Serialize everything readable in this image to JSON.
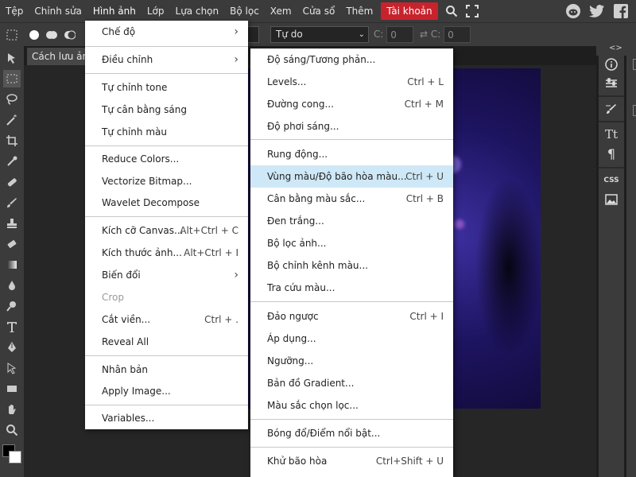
{
  "menubar": {
    "items": [
      "Tệp",
      "Chỉnh sửa",
      "Hình ảnh",
      "Lớp",
      "Lựa chọn",
      "Bộ lọc",
      "Xem",
      "Cửa sổ",
      "Thêm",
      "Tài khoản"
    ],
    "active_item": "Hình ảnh",
    "right_icons": [
      "reddit-icon",
      "twitter-icon",
      "facebook-icon"
    ]
  },
  "options_bar": {
    "style_select": "Tự do",
    "width_label": "C:",
    "width_value": "0",
    "height_label": "C:",
    "height_value": "0"
  },
  "document": {
    "tab_label": "Cách lưu ảnh"
  },
  "image_menu": {
    "items": [
      {
        "label": "Chế độ",
        "submenu": true
      },
      {
        "label": "Điều chỉnh",
        "submenu": true
      },
      {
        "label": "Tự chỉnh tone"
      },
      {
        "label": "Tự cân bằng sáng"
      },
      {
        "label": "Tự chỉnh màu"
      },
      {
        "label": "Reduce Colors..."
      },
      {
        "label": "Vectorize Bitmap..."
      },
      {
        "label": "Wavelet Decompose"
      },
      {
        "label": "Kích cỡ Canvas...",
        "shortcut": "Alt+Ctrl + C"
      },
      {
        "label": "Kích thước ảnh...",
        "shortcut": "Alt+Ctrl + I"
      },
      {
        "label": "Biến đổi",
        "submenu": true
      },
      {
        "label": "Crop",
        "disabled": true
      },
      {
        "label": "Cắt viền...",
        "shortcut": "Ctrl + ."
      },
      {
        "label": "Reveal All"
      },
      {
        "label": "Nhân bản"
      },
      {
        "label": "Apply Image..."
      },
      {
        "label": "Variables..."
      }
    ]
  },
  "adjust_menu": {
    "items": [
      {
        "label": "Độ sáng/Tương phản..."
      },
      {
        "label": "Levels...",
        "shortcut": "Ctrl + L"
      },
      {
        "label": "Đường cong...",
        "shortcut": "Ctrl + M"
      },
      {
        "label": "Độ phơi sáng..."
      },
      {
        "label": "Rung động..."
      },
      {
        "label": "Vùng màu/Độ bão hòa màu...",
        "shortcut": "Ctrl + U",
        "highlighted": true
      },
      {
        "label": "Cân bằng màu sắc...",
        "shortcut": "Ctrl + B"
      },
      {
        "label": "Đen trắng..."
      },
      {
        "label": "Bộ lọc ảnh..."
      },
      {
        "label": "Bộ chỉnh kênh màu..."
      },
      {
        "label": "Tra cứu màu..."
      },
      {
        "label": "Đảo ngược",
        "shortcut": "Ctrl + I"
      },
      {
        "label": "Áp dụng..."
      },
      {
        "label": "Ngưỡng..."
      },
      {
        "label": "Bản đồ Gradient..."
      },
      {
        "label": "Màu sắc chọn lọc..."
      },
      {
        "label": "Bóng đổ/Điểm nổi bật..."
      },
      {
        "label": "Khử bão hòa",
        "shortcut": "Ctrl+Shift + U"
      }
    ]
  },
  "right_panel": {
    "icons": [
      "info-icon",
      "adjustments-icon",
      "brush-settings-icon",
      "character-icon",
      "paragraph-icon",
      "css-icon",
      "image-icon"
    ],
    "css_label": "CSS",
    "character_glyph": "Tt",
    "paragraph_glyph": "¶"
  },
  "colors": {
    "menubar_bg": "#3b3b3b",
    "account_bg": "#c8232d",
    "highlight_bg": "#cfe8f7",
    "foreground": "#000000",
    "background": "#ffffff"
  }
}
